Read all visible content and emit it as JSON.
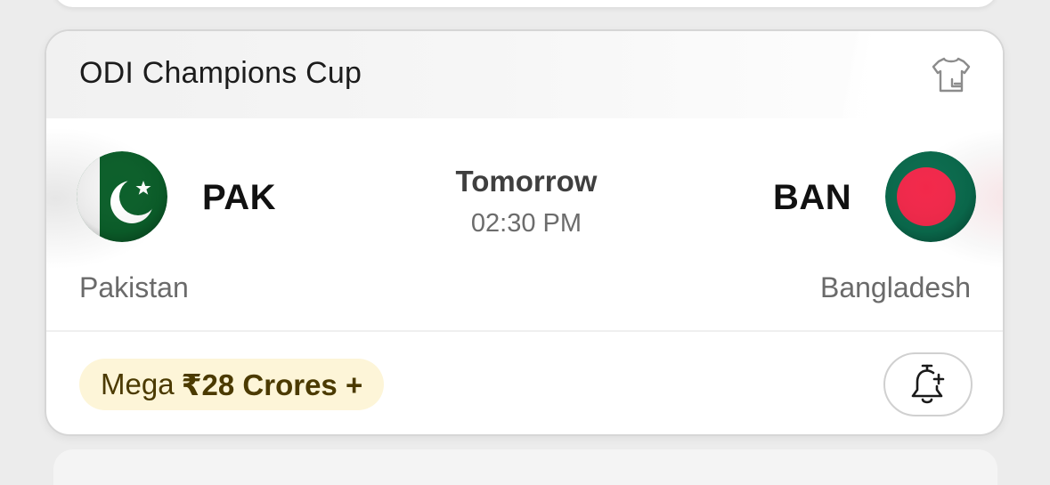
{
  "match": {
    "league": "ODI Champions Cup",
    "status": "Tomorrow",
    "time": "02:30 PM",
    "team_left": {
      "abbr": "PAK",
      "name": "Pakistan",
      "flag_icon": "pakistan-flag-icon",
      "flag_colors": [
        "#01411c",
        "#ffffff"
      ]
    },
    "team_right": {
      "abbr": "BAN",
      "name": "Bangladesh",
      "flag_icon": "bangladesh-flag-icon",
      "flag_colors": [
        "#006a4e",
        "#f42a41"
      ]
    },
    "prize": {
      "prefix": "Mega",
      "amount": "₹28 Crores +"
    },
    "icons": {
      "lineup": "jersey-lineup-icon",
      "reminder": "bell-plus-icon"
    }
  },
  "colors": {
    "card_background": "#ffffff",
    "card_border": "#d6d6d6",
    "prize_badge_background": "#fdf5d8",
    "prize_text": "#4b3a00"
  }
}
